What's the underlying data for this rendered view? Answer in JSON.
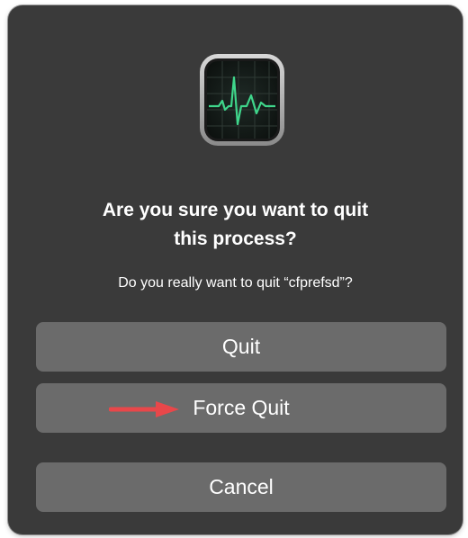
{
  "dialog": {
    "title_line1": "Are you sure you want to quit",
    "title_line2": "this process?",
    "message": "Do you really want to quit “cfprefsd”?",
    "app_icon": "activity-monitor-icon",
    "buttons": {
      "quit": "Quit",
      "force_quit": "Force Quit",
      "cancel": "Cancel"
    }
  },
  "colors": {
    "dialog_bg": "#3a3a3a",
    "button_bg": "#6b6b6b",
    "text": "#ffffff",
    "arrow": "#e8474a",
    "graph_line": "#3fd68b"
  }
}
